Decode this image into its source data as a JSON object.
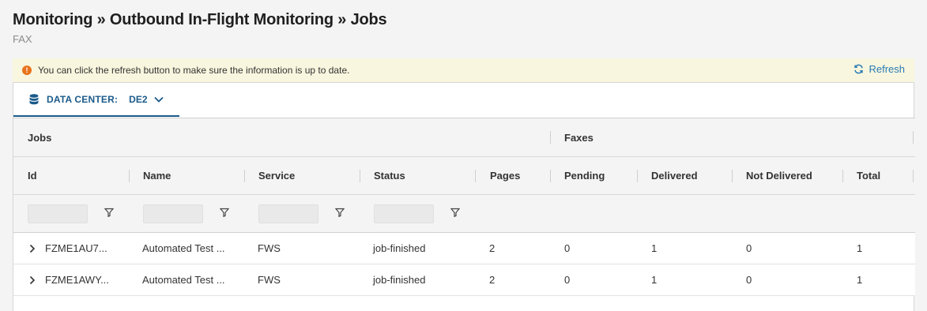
{
  "header": {
    "breadcrumb": "Monitoring » Outbound In-Flight Monitoring » Jobs",
    "subtitle": "FAX"
  },
  "banner": {
    "message": "You can click the refresh button to make sure the information is up to date.",
    "refresh_label": "Refresh",
    "warn_glyph": "!"
  },
  "datacenter": {
    "label": "DATA CENTER:",
    "value": "DE2"
  },
  "table": {
    "groups": {
      "jobs": "Jobs",
      "faxes": "Faxes"
    },
    "columns": [
      "Id",
      "Name",
      "Service",
      "Status",
      "Pages",
      "Pending",
      "Delivered",
      "Not Delivered",
      "Total"
    ],
    "rows": [
      [
        "FZME1AU7...",
        "Automated Test ...",
        "FWS",
        "job-finished",
        "2",
        "0",
        "1",
        "0",
        "1"
      ],
      [
        "FZME1AWY...",
        "Automated Test ...",
        "FWS",
        "job-finished",
        "2",
        "0",
        "1",
        "0",
        "1"
      ]
    ]
  },
  "colors": {
    "accent": "#1a5a8a",
    "link": "#2a7bb5",
    "warning": "#e8731c",
    "banner_bg": "#f8f6de"
  }
}
